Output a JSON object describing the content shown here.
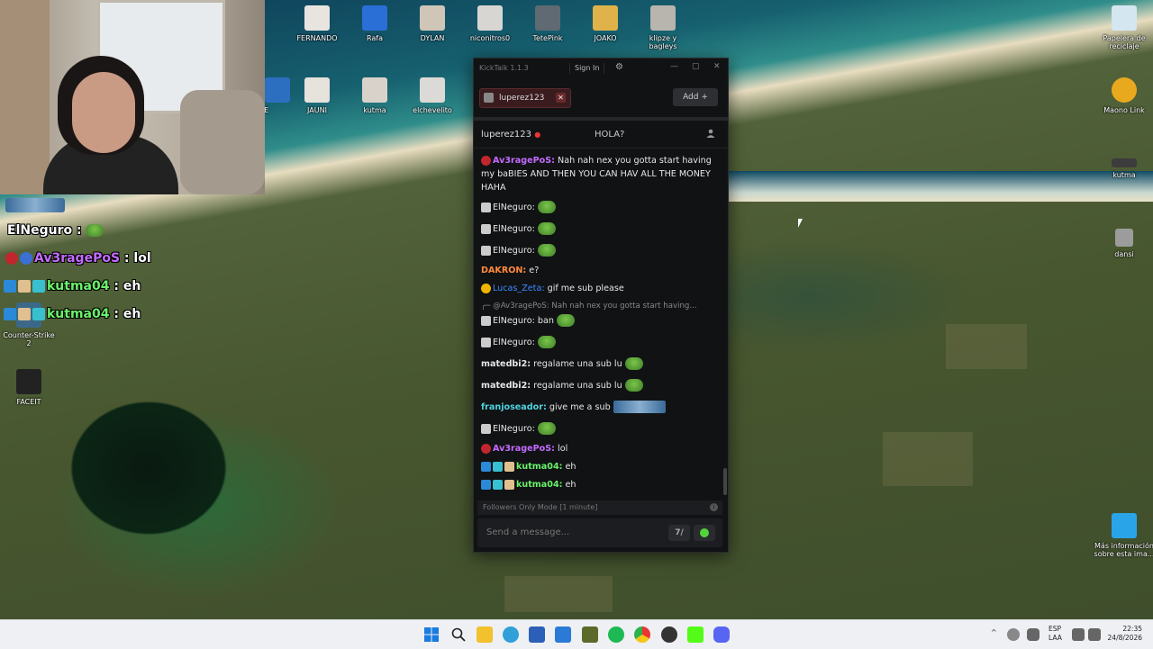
{
  "desktop_icons": [
    {
      "label": "FERNANDO",
      "color": "#e8e4df"
    },
    {
      "label": "Rafa",
      "color": "#2a6fd6"
    },
    {
      "label": "DYLAN",
      "color": "#cfc6b8"
    },
    {
      "label": "niconitros0",
      "color": "#d8d6d2"
    },
    {
      "label": "TetePink",
      "color": "#5f6a73"
    },
    {
      "label": "JOAKO",
      "color": "#e0b24a"
    },
    {
      "label": "klipze y bagleys",
      "color": "#b8b4ae"
    },
    {
      "label": "Papelera de reciclaje",
      "color": "#d4e6f0"
    },
    {
      "label": "KDE",
      "color": "#2c6fc0"
    },
    {
      "label": "JAUNI",
      "color": "#e6e2dc"
    },
    {
      "label": "kutma",
      "color": "#d9d2ca"
    },
    {
      "label": "elchevelito",
      "color": "#dcdad6"
    },
    {
      "label": "Maono Link",
      "color": "#e8a91e"
    },
    {
      "label": "kutma",
      "color": "#3c3c3c"
    },
    {
      "label": "dansi",
      "color": "#9c9c9c"
    },
    {
      "label": "Counter-Strike 2",
      "color": "#2f6fc2"
    },
    {
      "label": "FACEIT",
      "color": "#222222"
    },
    {
      "label": "Más información sobre esta ima...",
      "color": "#2aa4e8"
    }
  ],
  "overlay_chat": [
    {
      "user": "ElNeguro",
      "sep": " : ",
      "text": "",
      "color": "#ffffff"
    },
    {
      "user": "Av3ragePoS",
      "sep": " : ",
      "text": "lol",
      "color": "#c46bff"
    },
    {
      "user": "kutma04",
      "sep": " : ",
      "text": "eh",
      "color": "#6bf26b"
    },
    {
      "user": "kutma04",
      "sep": " : ",
      "text": "eh",
      "color": "#6bf26b"
    }
  ],
  "kicktalk": {
    "app_title": "KickTalk 1.1.3",
    "sign_in": "Sign In",
    "gear": "⚙",
    "min": "—",
    "max": "▢",
    "close": "✕",
    "tab_name": "luperez123",
    "tab_close": "✕",
    "add_label": "Add",
    "add_plus": "+",
    "channel_name": "luperez123",
    "channel_title": "HOLA?",
    "messages": [
      {
        "user": "Av3ragePoS:",
        "text": "Nah nah nex you gotta start having my baBIES AND THEN YOU CAN HAV ALL THE MONEY HAHA",
        "color": "#c46bff"
      },
      {
        "user": "ElNeguro:",
        "text": "",
        "color": "#e6e6e6"
      },
      {
        "user": "ElNeguro:",
        "text": "",
        "color": "#e6e6e6"
      },
      {
        "user": "ElNeguro:",
        "text": "",
        "color": "#e6e6e6"
      },
      {
        "user": "DAKRON:",
        "text": "e?",
        "color": "#ff8a3d"
      },
      {
        "user": "Lucas_Zeta:",
        "text": "gif me sub please",
        "color": "#3d8bff"
      },
      {
        "user": "@Av3ragePoS:",
        "text": "Nah nah nex you gotta start having...",
        "color": "#888888"
      },
      {
        "user": "ElNeguro:",
        "text": "ban",
        "color": "#e6e6e6"
      },
      {
        "user": "ElNeguro:",
        "text": "",
        "color": "#e6e6e6"
      },
      {
        "user": "matedbi2:",
        "text": "regalame una sub lu",
        "color": "#e6e6e6"
      },
      {
        "user": "matedbi2:",
        "text": "regalame una sub lu",
        "color": "#e6e6e6"
      },
      {
        "user": "franjoseador:",
        "text": "give me a sub",
        "color": "#4fd3e0"
      },
      {
        "user": "ElNeguro:",
        "text": "",
        "color": "#e6e6e6"
      },
      {
        "user": "Av3ragePoS:",
        "text": "lol",
        "color": "#c46bff"
      },
      {
        "user": "kutma04:",
        "text": "eh",
        "color": "#6bf26b"
      },
      {
        "user": "kutma04:",
        "text": "eh",
        "color": "#6bf26b"
      }
    ],
    "followers_mode": "Followers Only Mode [1 minute]",
    "followers_info": "i",
    "message_placeholder": "Send a message...",
    "emote_button": "7∕"
  },
  "taskbar": {
    "lang_top": "ESP",
    "lang_bottom": "LAA",
    "time": "22:35",
    "date": "24/8/2026",
    "tray_chevron": "^"
  }
}
